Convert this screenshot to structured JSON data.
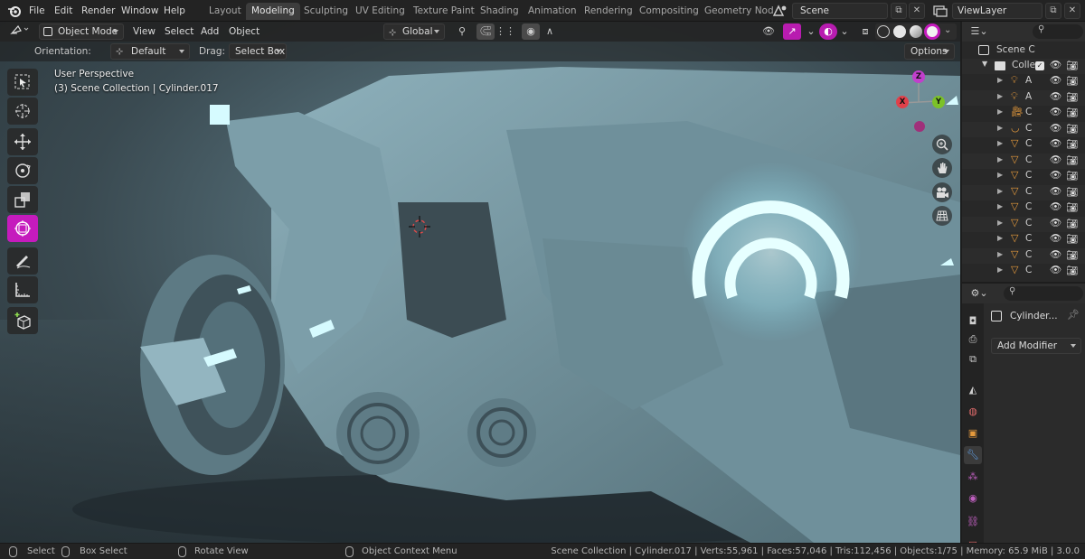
{
  "menubar": {
    "items": [
      "File",
      "Edit",
      "Render",
      "Window",
      "Help"
    ],
    "workspaces": [
      "Layout",
      "Modeling",
      "Sculpting",
      "UV Editing",
      "Texture Paint",
      "Shading",
      "Animation",
      "Rendering",
      "Compositing",
      "Geometry Nod"
    ],
    "active_workspace": "Modeling",
    "scene": "Scene",
    "view_layer": "ViewLayer"
  },
  "viewport_header": {
    "mode": "Object Mode",
    "menus": [
      "View",
      "Select",
      "Add",
      "Object"
    ],
    "transform_orientation": "Global",
    "icons": [
      "transform-pivot-icon",
      "snap-icon",
      "proportional-edit-icon",
      "visibility-icon",
      "gizmo-icon",
      "overlay-icon",
      "xray-icon",
      "shading-wireframe-icon",
      "shading-solid-icon",
      "shading-material-icon",
      "shading-rendered-icon"
    ]
  },
  "tool_settings": {
    "orientation_label": "Orientation:",
    "orientation_value": "Default",
    "drag_label": "Drag:",
    "drag_value": "Select Box",
    "options_label": "Options"
  },
  "viewport_overlay": {
    "perspective": "User Perspective",
    "collection_info": "(3) Scene Collection | Cylinder.017"
  },
  "toolbar": {
    "tools": [
      "select-box-icon",
      "cursor-icon",
      "move-icon",
      "rotate-icon",
      "scale-icon",
      "transform-icon",
      "annotate-icon",
      "measure-icon",
      "add-cube-icon"
    ],
    "active_tool": "transform-icon"
  },
  "navigation_gizmo": {
    "axes": {
      "z": "Z",
      "x": "X",
      "y": "Y"
    },
    "colors": {
      "z": "#c13fcc",
      "x": "#e0404a",
      "y": "#7cc228",
      "neg_z": "#a0307a"
    }
  },
  "outliner": {
    "scene_collection": "Scene C",
    "collection": "Colle",
    "rows": [
      {
        "type": "light",
        "label": "A"
      },
      {
        "type": "light",
        "label": "A"
      },
      {
        "type": "camera",
        "label": "C"
      },
      {
        "type": "curve",
        "label": "C"
      },
      {
        "type": "mesh",
        "label": "C"
      },
      {
        "type": "mesh",
        "label": "C"
      },
      {
        "type": "mesh",
        "label": "C"
      },
      {
        "type": "mesh",
        "label": "C"
      },
      {
        "type": "mesh",
        "label": "C"
      },
      {
        "type": "mesh",
        "label": "C"
      },
      {
        "type": "mesh",
        "label": "C"
      },
      {
        "type": "mesh",
        "label": "C"
      },
      {
        "type": "mesh",
        "label": "C"
      }
    ]
  },
  "properties": {
    "object_name": "Cylinder...",
    "add_modifier": "Add Modifier",
    "tabs": [
      "render-tab-icon",
      "output-tab-icon",
      "view-layer-tab-icon",
      "scene-tab-icon",
      "world-tab-icon",
      "object-tab-icon",
      "modifier-tab-icon",
      "particles-tab-icon",
      "physics-tab-icon",
      "constraints-tab-icon",
      "data-tab-icon"
    ],
    "active_tab": "modifier-tab-icon"
  },
  "statusbar": {
    "select": "Select",
    "box_select": "Box Select",
    "rotate_view": "Rotate View",
    "context_menu": "Object Context Menu",
    "stats": "Scene Collection | Cylinder.017 | Verts:55,961 | Faces:57,046 | Tris:112,456 | Objects:1/75 | Memory: 65.9 MiB | 3.0.0"
  },
  "colors": {
    "accent": "#c51bbd",
    "active_tab_bg": "#3d3d3d",
    "glow": "#bff7ff"
  }
}
